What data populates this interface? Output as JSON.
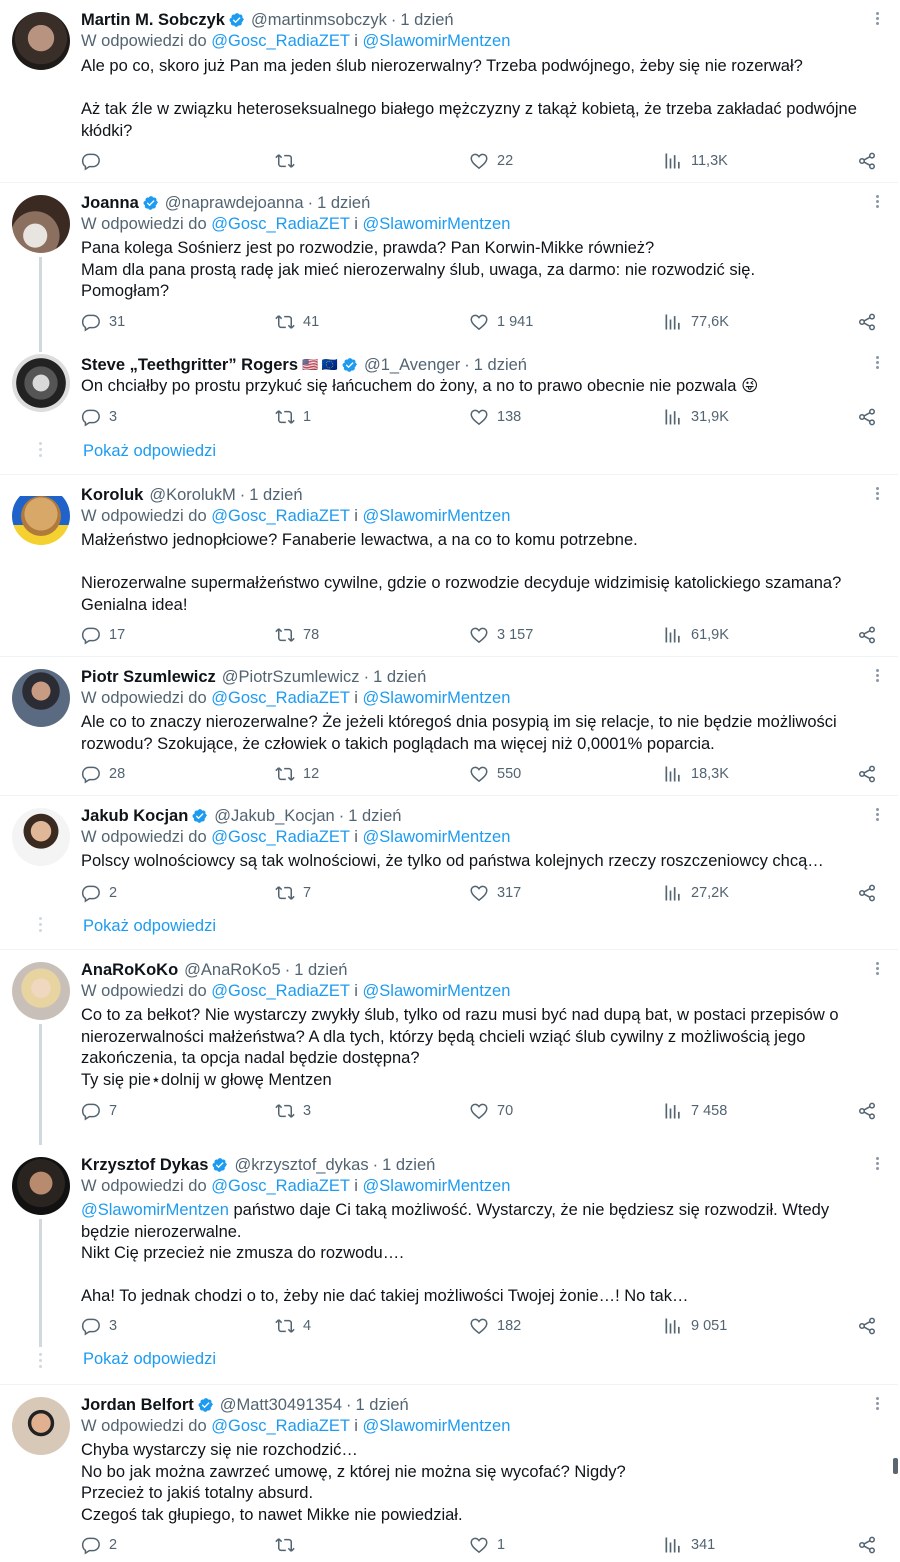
{
  "common": {
    "reply_prefix": "W odpowiedzi do",
    "reply_target1": "@Gosc_RadiaZET",
    "reply_and": "i",
    "reply_target2": "@SlawomirMentzen",
    "show_replies": "Pokaż odpowiedzi",
    "dot": "·"
  },
  "tweets": [
    {
      "name": "Martin M. Sobczyk",
      "handle": "@martinmsobczyk",
      "time": "1 dzień",
      "body": "Ale po co, skoro już Pan ma jeden ślub nierozerwalny? Trzeba podwójnego, żeby się nie rozerwał?\n\nAż tak źle w związku heteroseksualnego białego mężczyzny z takąż kobietą, że trzeba zakładać podwójne kłódki?",
      "replies": "",
      "retweets": "",
      "likes": "22",
      "views": "11,3K"
    },
    {
      "name": "Joanna",
      "handle": "@naprawdejoanna",
      "time": "1 dzień",
      "body": "Pana kolega Sośnierz jest po rozwodzie, prawda? Pan Korwin-Mikke również?\nMam dla pana prostą radę jak mieć nierozerwalny ślub, uwaga, za darmo: nie rozwodzić się.\nPomogłam?",
      "replies": "31",
      "retweets": "41",
      "likes": "1 941",
      "views": "77,6K"
    },
    {
      "name": "Steve „Teethgritter” Rogers",
      "flags": "🇺🇸 🇪🇺",
      "handle": "@1_Avenger",
      "time": "1 dzień",
      "body": "On chciałby po prostu przykuć się łańcuchem do żony, a no to prawo obecnie nie pozwala 😜",
      "replies": "3",
      "retweets": "1",
      "likes": "138",
      "views": "31,9K"
    },
    {
      "name": "Koroluk",
      "handle": "@KorolukM",
      "time": "1 dzień",
      "body": "Małżeństwo jednopłciowe? Fanaberie lewactwa, a na co to komu potrzebne.\n\nNierozerwalne supermałżeństwo cywilne, gdzie o rozwodzie decyduje widzimisię katolickiego szamana? Genialna idea!",
      "replies": "17",
      "retweets": "78",
      "likes": "3 157",
      "views": "61,9K"
    },
    {
      "name": "Piotr Szumlewicz",
      "handle": "@PiotrSzumlewicz",
      "time": "1 dzień",
      "body": "Ale co to znaczy nierozerwalne? Że jeżeli któregoś dnia posypią im się relacje, to nie będzie możliwości rozwodu? Szokujące, że człowiek o takich poglądach ma więcej niż 0,0001% poparcia.",
      "replies": "28",
      "retweets": "12",
      "likes": "550",
      "views": "18,3K"
    },
    {
      "name": "Jakub Kocjan",
      "handle": "@Jakub_Kocjan",
      "time": "1 dzień",
      "body": "Polscy wolnościowcy są tak wolnościowi, że tylko od państwa kolejnych rzeczy roszczeniowcy chcą…",
      "replies": "2",
      "retweets": "7",
      "likes": "317",
      "views": "27,2K"
    },
    {
      "name": "AnaRoKoKo",
      "handle": "@AnaRoKo5",
      "time": "1 dzień",
      "body": "Co to za bełkot? Nie wystarczy zwykły ślub, tylko od razu musi być nad dupą bat, w postaci przepisów o nierozerwalności małżeństwa? A dla tych, którzy będą chcieli wziąć ślub cywilny z możliwością jego zakończenia, ta opcja nadal będzie dostępna?\nTy się pie⋆dolnij w głowę Mentzen",
      "replies": "7",
      "retweets": "3",
      "likes": "70",
      "views": "7 458"
    },
    {
      "name": "Krzysztof Dykas",
      "handle": "@krzysztof_dykas",
      "time": "1 dzień",
      "body_mention": "@SlawomirMentzen",
      "body": " państwo daje Ci taką możliwość. Wystarczy, że nie będziesz się rozwodził. Wtedy będzie nierozerwalne.\nNikt Cię przecież nie zmusza do rozwodu….\n\nAha! To jednak chodzi o to, żeby nie dać takiej możliwości Twojej żonie…! No tak…",
      "replies": "3",
      "retweets": "4",
      "likes": "182",
      "views": "9 051"
    },
    {
      "name": "Jordan Belfort",
      "handle": "@Matt30491354",
      "time": "1 dzień",
      "body": "Chyba wystarczy się nie rozchodzić…\nNo bo jak można zawrzeć umowę, z której nie można się wycofać? Nigdy?\nPrzecież to jakiś totalny absurd.\nCzegoś tak głupiego, to nawet Mikke nie powiedział.",
      "replies": "2",
      "retweets": "",
      "likes": "1",
      "views": "341"
    }
  ],
  "colors": {
    "link": "#1d9bf0",
    "muted": "#536471",
    "verified": "#1d9bf0",
    "divider": "#eff3f4"
  }
}
